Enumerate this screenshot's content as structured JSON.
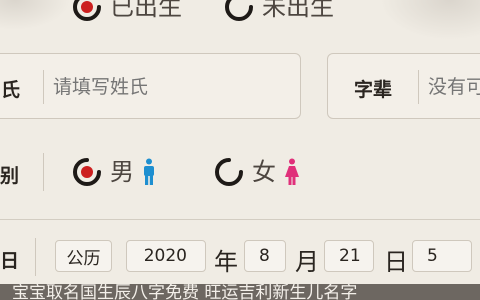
{
  "birth_status": {
    "options": [
      {
        "label": "已出生",
        "selected": true
      },
      {
        "label": "未出生",
        "selected": false
      }
    ]
  },
  "surname": {
    "title": "姓氏",
    "title_visible": "氏",
    "placeholder": "请填写姓氏"
  },
  "generation": {
    "title": "字辈",
    "placeholder": "没有可"
  },
  "gender": {
    "label_visible": "别",
    "options": [
      {
        "label": "男",
        "icon": "male-icon",
        "selected": true
      },
      {
        "label": "女",
        "icon": "female-icon",
        "selected": false
      }
    ]
  },
  "date": {
    "label_visible": "日",
    "calendar": "公历",
    "year": "2020",
    "year_unit": "年",
    "month": "8",
    "month_unit": "月",
    "day": "21",
    "day_unit": "日",
    "hour": "5"
  },
  "footer": {
    "text": "宝宝取名国生辰八字免费 旺运吉利新生儿名字"
  },
  "colors": {
    "background": "#f0ece4",
    "radio_selected": "#cc1f1f",
    "male": "#1e8fd0",
    "female": "#e0307a",
    "footer_bg": "#6d6761"
  }
}
